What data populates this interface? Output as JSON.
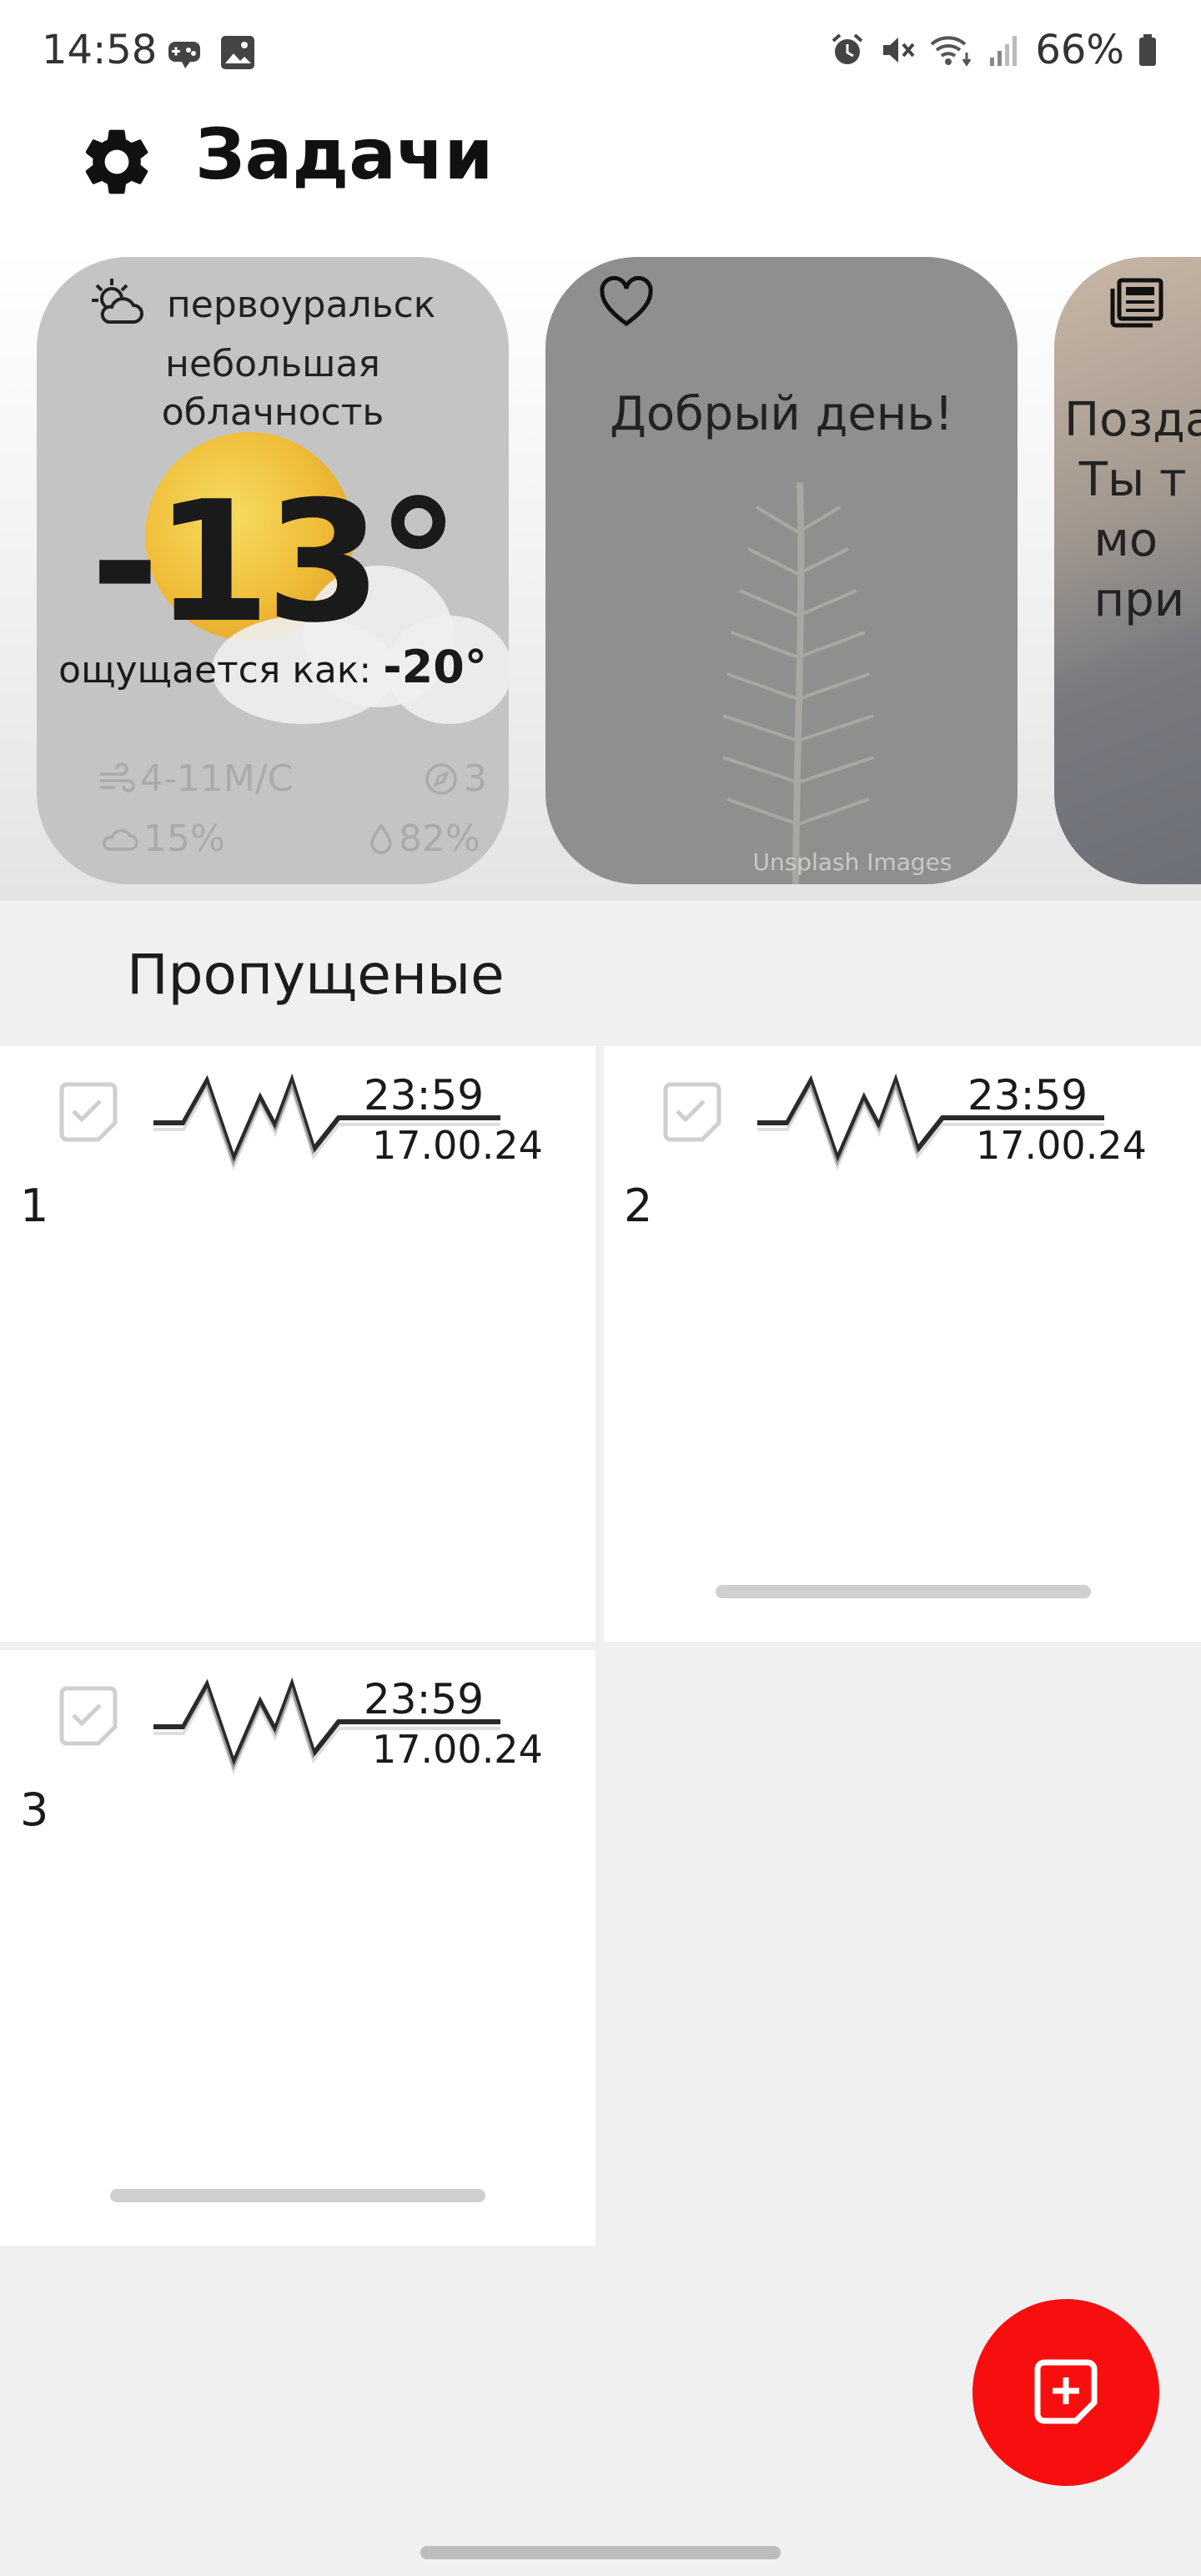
{
  "status_bar": {
    "time": "14:58",
    "battery": "66%",
    "left_icons": [
      "game-controller-icon",
      "image-icon"
    ],
    "right_icons": [
      "alarm-icon",
      "mute-icon",
      "wifi-icon",
      "signal-icon",
      "battery-icon"
    ]
  },
  "header": {
    "title": "Задачи",
    "settings_icon": "gear-icon"
  },
  "cards": {
    "weather": {
      "city": "первоуральск",
      "description": "небольшая облачность",
      "temperature": "-13°",
      "feels_like_label": "ощущается как:",
      "feels_like_value": "-20°",
      "wind": "4-11М/С",
      "direction": "3",
      "cloudiness": "15%",
      "humidity": "82%"
    },
    "greeting": {
      "text": "Добрый день!",
      "credit": "Unsplash Images"
    },
    "news": {
      "text": "Позда\n Ты т\n  мо\n  при"
    }
  },
  "section": {
    "title": "Пропущеные"
  },
  "tasks": [
    {
      "number": "1",
      "time": "23:59",
      "date": "17.00.24"
    },
    {
      "number": "2",
      "time": "23:59",
      "date": "17.00.24"
    },
    {
      "number": "3",
      "time": "23:59",
      "date": "17.00.24"
    }
  ],
  "fab": {
    "icon": "add-note-icon"
  },
  "colors": {
    "accent": "#f70f0f",
    "background": "#f0f0f0",
    "tile": "#ffffff"
  }
}
